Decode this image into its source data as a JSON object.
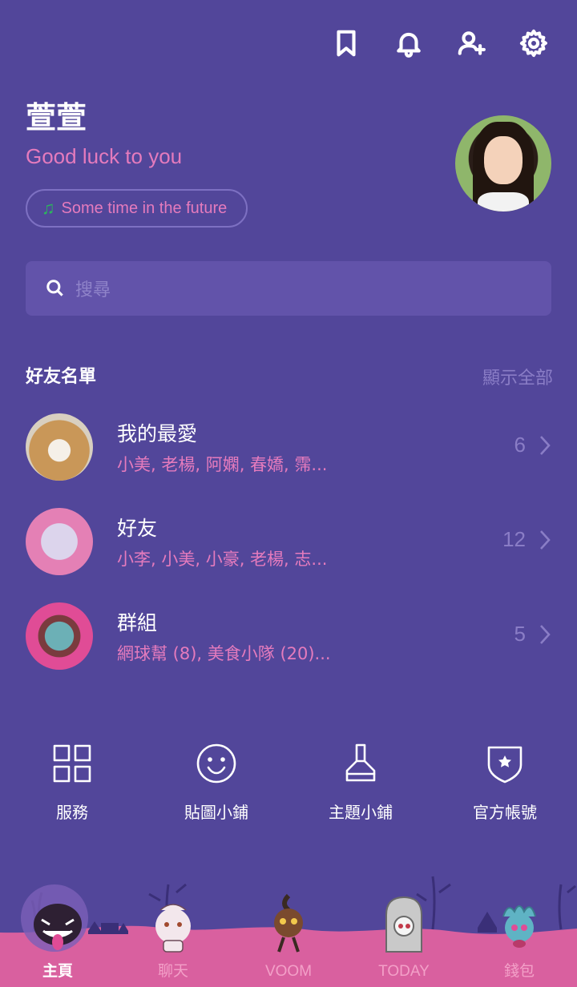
{
  "header": {
    "icons": [
      "bookmark-icon",
      "bell-icon",
      "add-friend-icon",
      "gear-icon"
    ]
  },
  "profile": {
    "name": "萱萱",
    "status_message": "Good luck to you",
    "music": "Some time in the future",
    "music_icon": "music-note-icon"
  },
  "search": {
    "placeholder": "搜尋"
  },
  "friends_section": {
    "title": "好友名單",
    "show_all": "顯示全部",
    "rows": [
      {
        "label": "我的最愛",
        "members": "小美, 老楊, 阿嫻, 春嬌, 霈...",
        "count": "6"
      },
      {
        "label": "好友",
        "members": "小李, 小美, 小豪, 老楊, 志...",
        "count": "12"
      },
      {
        "label": "群組",
        "members": "網球幫 (8), 美食小隊 (20)...",
        "count": "5"
      }
    ]
  },
  "services": [
    {
      "label": "服務",
      "icon": "grid-icon"
    },
    {
      "label": "貼圖小鋪",
      "icon": "smiley-icon"
    },
    {
      "label": "主題小鋪",
      "icon": "brush-icon"
    },
    {
      "label": "官方帳號",
      "icon": "shield-star-icon"
    }
  ],
  "tabs": [
    {
      "label": "主頁",
      "active": true
    },
    {
      "label": "聊天",
      "active": false
    },
    {
      "label": "VOOM",
      "active": false
    },
    {
      "label": "TODAY",
      "active": false
    },
    {
      "label": "錢包",
      "active": false
    }
  ],
  "colors": {
    "background": "#52469a",
    "accent_pink": "#e57bbd",
    "muted_purple": "#8a7dc6",
    "search_bg": "#6253aa",
    "music_green": "#2bb85c"
  }
}
